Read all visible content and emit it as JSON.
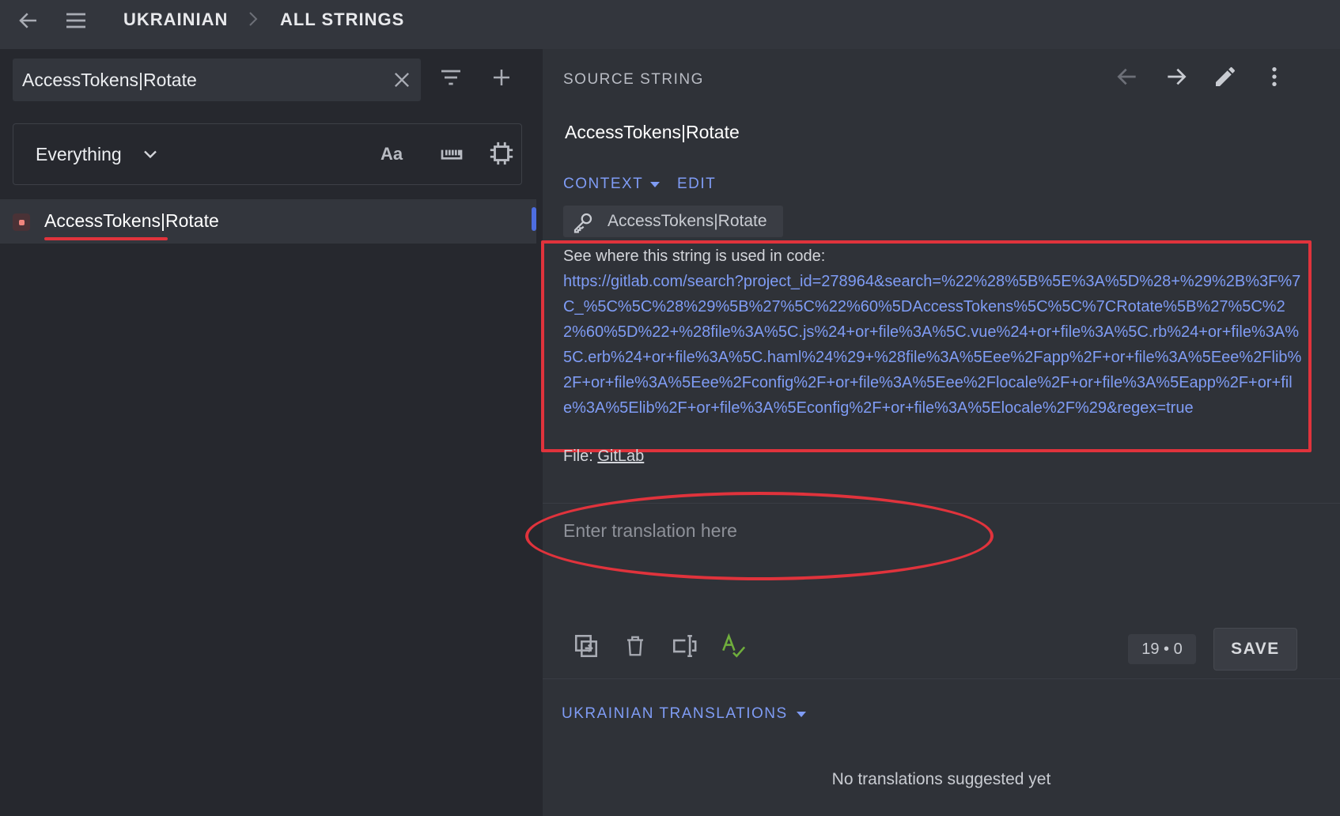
{
  "topbar": {
    "breadcrumb_language": "UKRAINIAN",
    "breadcrumb_section": "ALL STRINGS"
  },
  "search": {
    "value": "AccessTokens|Rotate"
  },
  "filter": {
    "selected": "Everything",
    "case_label": "Aa"
  },
  "string_list": [
    {
      "text": "AccessTokens|Rotate",
      "status": "missing"
    }
  ],
  "source": {
    "section_title": "SOURCE STRING",
    "text": "AccessTokens|Rotate",
    "context_label": "CONTEXT",
    "edit_label": "EDIT",
    "key": "AccessTokens|Rotate",
    "code_hint": "See where this string is used in code:",
    "code_url": "https://gitlab.com/search?project_id=278964&search=%22%28%5B%5E%3A%5D%28+%29%2B%3F%7C_%5C%5C%28%29%5B%27%5C%22%60%5DAccessTokens%5C%5C%7CRotate%5B%27%5C%22%60%5D%22+%28file%3A%5C.js%24+or+file%3A%5C.vue%24+or+file%3A%5C.rb%24+or+file%3A%5C.erb%24+or+file%3A%5C.haml%24%29+%28file%3A%5Eee%2Fapp%2F+or+file%3A%5Eee%2Flib%2F+or+file%3A%5Eee%2Fconfig%2F+or+file%3A%5Eee%2Flocale%2F+or+file%3A%5Eapp%2F+or+file%3A%5Elib%2F+or+file%3A%5Econfig%2F+or+file%3A%5Elocale%2F%29&regex=true",
    "file_label": "File:",
    "file_name": "GitLab"
  },
  "editor": {
    "placeholder": "Enter translation here",
    "count": "19 • 0",
    "save_label": "SAVE"
  },
  "translations": {
    "section_title": "UKRAINIAN TRANSLATIONS",
    "empty_text": "No translations suggested yet"
  },
  "colors": {
    "accent": "#7f9cf5",
    "annotation_red": "#e0333c",
    "status_missing": "#f0857d",
    "spellcheck_green": "#6fae3c"
  },
  "icons": {
    "back": "arrow-left-icon",
    "menu": "hamburger-icon",
    "clear": "close-icon",
    "filter": "filter-icon",
    "add": "plus-icon",
    "dropdown": "chevron-down-icon",
    "keyboard": "keyboard-icon",
    "frame": "frame-icon",
    "prev": "arrow-left-icon",
    "next": "arrow-right-icon",
    "edit": "pencil-icon",
    "more": "more-vertical-icon",
    "key": "key-icon",
    "copy": "copy-icon",
    "delete": "trash-icon",
    "insert": "insert-icon",
    "spellcheck": "spellcheck-icon"
  }
}
